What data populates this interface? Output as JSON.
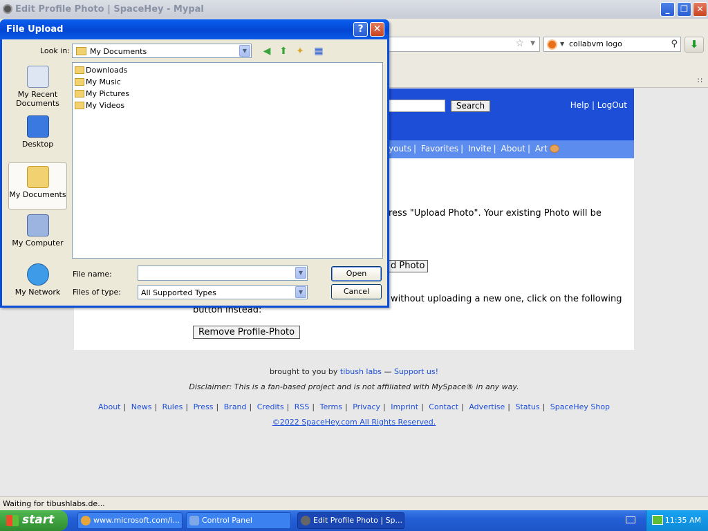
{
  "browser": {
    "title": "Edit Profile Photo | SpaceHey - Mypal",
    "search_value": "collabvm logo",
    "status": "Waiting for tibushlabs.de..."
  },
  "site": {
    "search_button": "Search",
    "help": "Help",
    "logout": "LogOut",
    "nav": [
      "youts",
      "Favorites",
      "Invite",
      "About",
      "Art"
    ],
    "intro_text": "ress \"Upload Photo\". Your existing Photo will be",
    "upload_button": "d Photo",
    "remove_text_a": "without uploading a new one, click on the following",
    "remove_text_b": "button instead:",
    "remove_button": "Remove Profile-Photo"
  },
  "footer": {
    "brought": "brought to you by",
    "tibush": "tibush labs",
    "dash": "—",
    "support": "Support us!",
    "disclaimer_label": "Disclaimer:",
    "disclaimer": "This is a fan-based project and is not affiliated with MySpace® in any way.",
    "links": [
      "About",
      "News",
      "Rules",
      "Press",
      "Brand",
      "Credits",
      "RSS",
      "Terms",
      "Privacy",
      "Imprint",
      "Contact",
      "Advertise",
      "Status",
      "SpaceHey Shop"
    ],
    "copyright": "©2022 SpaceHey.com All Rights Reserved."
  },
  "dialog": {
    "title": "File Upload",
    "lookin_label": "Look in:",
    "lookin_value": "My Documents",
    "places": [
      "My Recent Documents",
      "Desktop",
      "My Documents",
      "My Computer",
      "My Network"
    ],
    "files": [
      "Downloads",
      "My Music",
      "My Pictures",
      "My Videos"
    ],
    "filename_label": "File name:",
    "filename_value": "",
    "filetype_label": "Files of type:",
    "filetype_value": "All Supported Types",
    "open": "Open",
    "cancel": "Cancel"
  },
  "taskbar": {
    "start": "start",
    "tasks": [
      "www.microsoft.com/i...",
      "Control Panel",
      "Edit Profile Photo | Sp..."
    ],
    "clock": "11:35 AM"
  }
}
